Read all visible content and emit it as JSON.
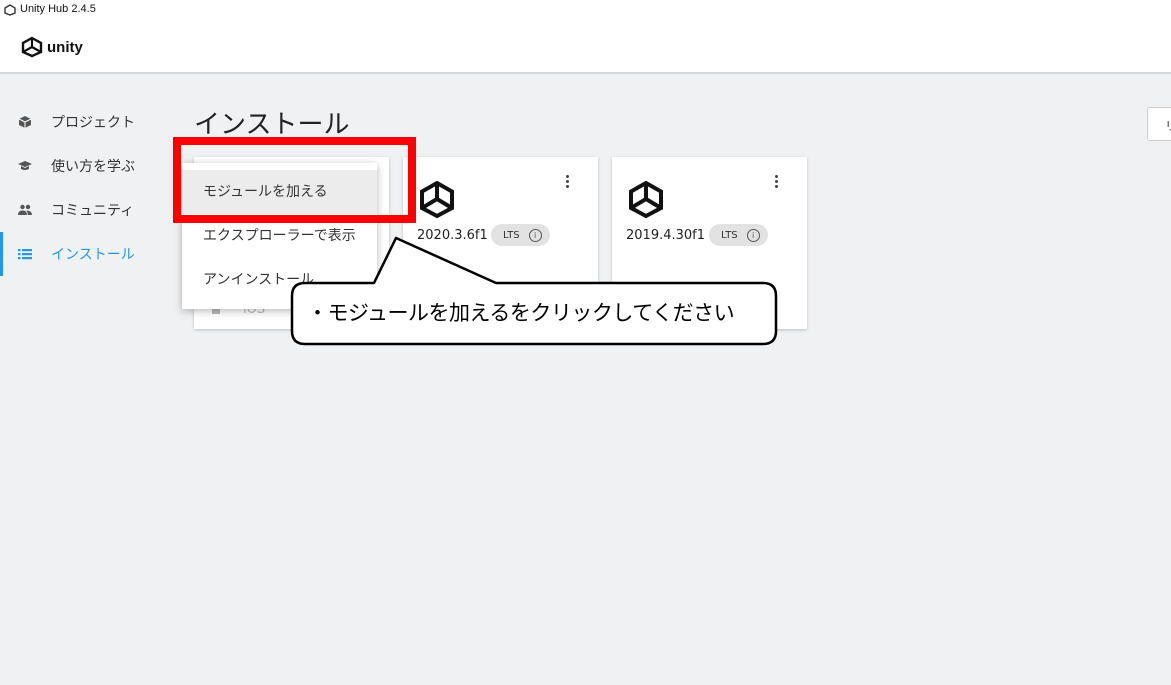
{
  "window": {
    "title": "Unity Hub 2.4.5"
  },
  "header": {
    "logo_text": "unity"
  },
  "sidebar": {
    "items": [
      {
        "label": "プロジェクト",
        "icon": "cube-icon"
      },
      {
        "label": "使い方を学ぶ",
        "icon": "graduation-cap-icon"
      },
      {
        "label": "コミュニティ",
        "icon": "people-icon"
      },
      {
        "label": "インストール",
        "icon": "list-icon",
        "active": true
      }
    ]
  },
  "main": {
    "title": "インストール",
    "right_button_label": "リ"
  },
  "installs": [
    {
      "platform_label": "iOS"
    },
    {
      "version": "2020.3.6f1",
      "badge": "LTS",
      "info_glyph": "i"
    },
    {
      "version": "2019.4.30f1",
      "badge": "LTS",
      "info_glyph": "i"
    }
  ],
  "context_menu": {
    "items": [
      {
        "label": "モジュールを加える"
      },
      {
        "label": "エクスプローラーで表示"
      },
      {
        "label": "アンインストール"
      }
    ]
  },
  "annotation": {
    "callout_text": "・モジュールを加えるをクリックしてください",
    "highlight_color": "#ff0000"
  },
  "colors": {
    "accent": "#2196f3",
    "background": "#f0f1f3"
  }
}
